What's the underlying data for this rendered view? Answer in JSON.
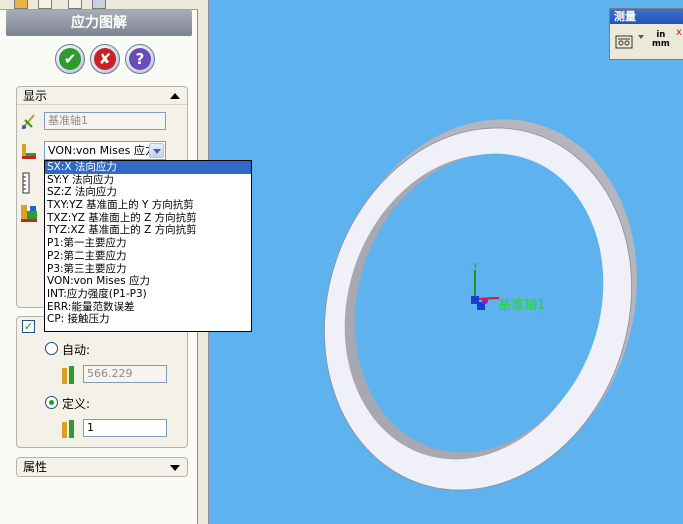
{
  "panel": {
    "title": "应力图解",
    "buttons": {
      "ok": "✔",
      "cancel": "✘",
      "help": "?"
    },
    "display_group": {
      "header": "显示",
      "reference_axis_placeholder": "基准轴1",
      "component_selected": "VON:von Mises 应力"
    },
    "component_options": [
      "SX:X 法向应力",
      "SY:Y 法向应力",
      "SZ:Z 法向应力",
      "TXY:YZ 基准面上的 Y 方向抗剪",
      "TXZ:YZ 基准面上的 Z 方向抗剪",
      "TYZ:XZ 基准面上的 Z 方向抗剪",
      "P1:第一主要应力",
      "P2:第二主要应力",
      "P3:第三主要应力",
      "VON:von Mises 应力",
      "INT:应力强度(P1-P3)",
      "ERR:能量范数误差",
      "CP: 接触压力"
    ],
    "deform_group": {
      "auto_label": "自动:",
      "auto_value": "566.229",
      "custom_label": "定义:",
      "custom_value": "1"
    },
    "properties_group": {
      "header": "属性"
    }
  },
  "measure_toolbar": {
    "title": "测量",
    "units_top": "in",
    "units_bottom": "mm"
  },
  "viewport": {
    "axis_label": "基准轴1",
    "y_label": "Y"
  },
  "colors": {
    "viewport_bg": "#5eb2ee",
    "ring_face": "#f0f1fa",
    "ring_side": "#b0b0b8",
    "selection": "#316ac5"
  }
}
